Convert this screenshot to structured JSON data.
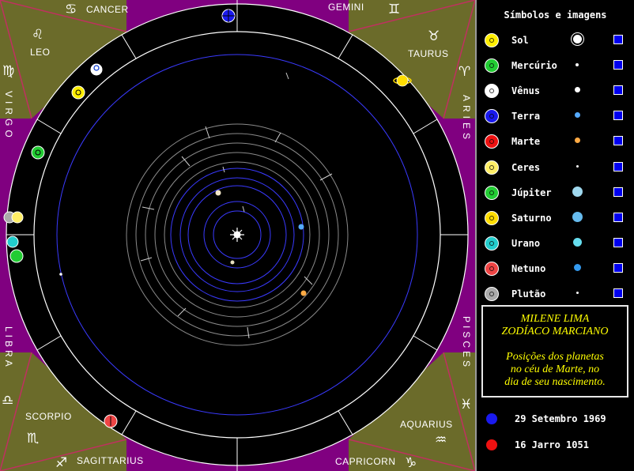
{
  "zodiac": {
    "cancer": "CANCER",
    "gemini": "GEMINI",
    "leo": "LEO",
    "taurus": "TAURUS",
    "virgo": "VIRGO",
    "aries": "ARIES",
    "libra": "LIBRA",
    "pisces": "PISCES",
    "scorpio": "SCORPIO",
    "aquarius": "AQUARIUS",
    "sagittarius": "SAGITTARIUS",
    "capricorn": "CAPRICORN"
  },
  "zodiac_symbols": {
    "cancer": "♋",
    "gemini": "♊",
    "leo": "♌",
    "taurus": "♉",
    "virgo": "♍",
    "aries": "♈",
    "libra": "♎",
    "pisces": "♓",
    "scorpio": "♏",
    "aquarius": "♒",
    "sagittarius": "♐",
    "capricorn": "♑"
  },
  "colors": {
    "corner_fill": "#6b6b2a",
    "frame_purple": "#800080",
    "orbit_blue": "#3a3aff",
    "checkbox_blue": "#0000ee",
    "info_text": "#ffff00"
  },
  "legend": {
    "title": "Símbolos e imagens",
    "planets": [
      {
        "label": "Sol",
        "symbol_color": "#ffee00",
        "image": "sun-image-icon"
      },
      {
        "label": "Mercúrio",
        "symbol_color": "#22cc33",
        "image": "mercury-image-icon"
      },
      {
        "label": "Vênus",
        "symbol_color": "#ffffff",
        "image": "venus-image-icon"
      },
      {
        "label": "Terra",
        "symbol_color": "#1a1aee",
        "image": "earth-image-icon"
      },
      {
        "label": "Marte",
        "symbol_color": "#ee1111",
        "image": "mars-image-icon"
      },
      {
        "label": "Ceres",
        "symbol_color": "#ffee66",
        "image": "ceres-image-icon"
      },
      {
        "label": "Júpiter",
        "symbol_color": "#22cc33",
        "image": "jupiter-image-icon"
      },
      {
        "label": "Saturno",
        "symbol_color": "#ffdd00",
        "image": "saturn-image-icon"
      },
      {
        "label": "Urano",
        "symbol_color": "#22cccc",
        "image": "uranus-image-icon"
      },
      {
        "label": "Netuno",
        "symbol_color": "#ee4444",
        "image": "neptune-image-icon"
      },
      {
        "label": "Plutão",
        "symbol_color": "#aaaaaa",
        "image": "pluto-image-icon"
      }
    ]
  },
  "info": {
    "name_line1": "MILENE LIMA",
    "name_line2": "ZODÍACO MARCIANO",
    "desc_line1": "Posições dos planetas",
    "desc_line2": "no céu de Marte, no",
    "desc_line3": "dia de seu nascimento."
  },
  "dates": {
    "earth_date": "29 Setembro 1969",
    "mars_date": "16 Jarro 1051"
  }
}
